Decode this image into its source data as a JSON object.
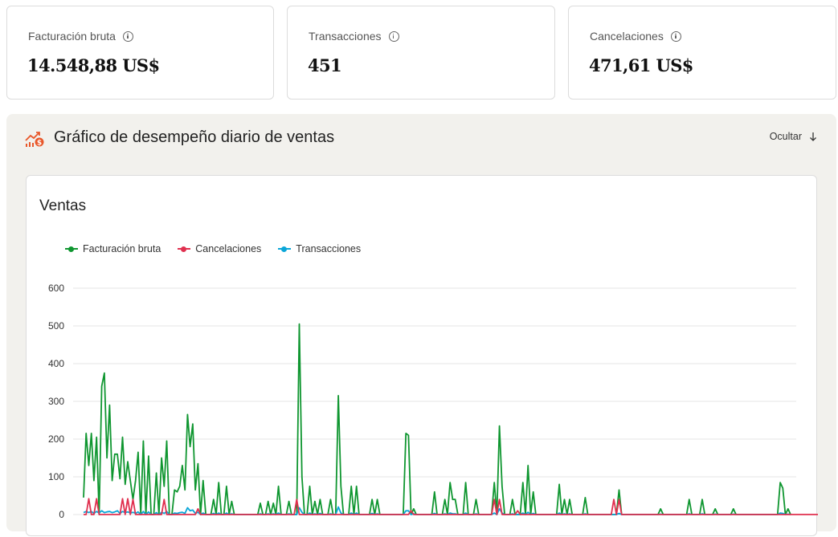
{
  "kpis": [
    {
      "label": "Facturación bruta",
      "value": "14.548,88 US$"
    },
    {
      "label": "Transacciones",
      "value": "451"
    },
    {
      "label": "Cancelaciones",
      "value": "471,61 US$"
    }
  ],
  "panel": {
    "title": "Gráfico de desempeño diario de ventas",
    "hide_label": "Ocultar"
  },
  "chart_data": {
    "type": "line",
    "title": "Ventas",
    "ylim": [
      0,
      600
    ],
    "yticks": [
      0,
      100,
      200,
      300,
      400,
      500,
      600
    ],
    "grid": true,
    "legend_position": "top-left",
    "colors": {
      "Facturación bruta": "#0f9630",
      "Cancelaciones": "#e0304f",
      "Transacciones": "#0aa6d8"
    },
    "series": [
      {
        "name": "Facturación bruta",
        "values": [
          45,
          215,
          130,
          215,
          90,
          205,
          0,
          340,
          375,
          150,
          290,
          90,
          160,
          160,
          95,
          205,
          80,
          140,
          90,
          40,
          90,
          165,
          0,
          195,
          0,
          155,
          0,
          0,
          110,
          0,
          150,
          75,
          195,
          0,
          0,
          65,
          60,
          75,
          130,
          65,
          265,
          180,
          240,
          65,
          135,
          0,
          90,
          0,
          0,
          0,
          40,
          0,
          85,
          0,
          0,
          75,
          0,
          35,
          0,
          0,
          0,
          0,
          0,
          0,
          0,
          0,
          0,
          0,
          30,
          0,
          0,
          35,
          0,
          30,
          0,
          75,
          0,
          0,
          0,
          35,
          0,
          0,
          0,
          505,
          100,
          0,
          0,
          75,
          0,
          35,
          0,
          40,
          0,
          0,
          0,
          40,
          0,
          0,
          315,
          75,
          0,
          0,
          0,
          75,
          0,
          75,
          0,
          0,
          0,
          0,
          0,
          40,
          0,
          40,
          0,
          0,
          0,
          0,
          0,
          0,
          0,
          0,
          0,
          0,
          215,
          210,
          0,
          15,
          0,
          0,
          0,
          0,
          0,
          0,
          0,
          60,
          0,
          0,
          0,
          40,
          0,
          85,
          40,
          40,
          0,
          0,
          0,
          85,
          0,
          0,
          0,
          40,
          0,
          0,
          0,
          0,
          0,
          0,
          85,
          0,
          235,
          75,
          0,
          0,
          0,
          40,
          0,
          0,
          0,
          85,
          0,
          130,
          0,
          60,
          0,
          0,
          0,
          0,
          0,
          0,
          0,
          0,
          0,
          80,
          0,
          40,
          0,
          40,
          0,
          0,
          0,
          0,
          0,
          45,
          0,
          0,
          0,
          0,
          0,
          0,
          0,
          0,
          0,
          0,
          0,
          0,
          65,
          0,
          0,
          0,
          0,
          0,
          0,
          0,
          0,
          0,
          0,
          0,
          0,
          0,
          0,
          0,
          15,
          0,
          0,
          0,
          0,
          0,
          0,
          0,
          0,
          0,
          0,
          40,
          0,
          0,
          0,
          0,
          40,
          0,
          0,
          0,
          0,
          15,
          0,
          0,
          0,
          0,
          0,
          0,
          15,
          0,
          0,
          0,
          0,
          0,
          0,
          0,
          0,
          0,
          0,
          0,
          0,
          0,
          0,
          0,
          0,
          0,
          85,
          70,
          0,
          15,
          0
        ]
      },
      {
        "name": "Cancelaciones",
        "values": [
          0,
          0,
          42,
          0,
          0,
          42,
          0,
          0,
          0,
          0,
          0,
          0,
          0,
          0,
          0,
          42,
          0,
          42,
          0,
          40,
          0,
          0,
          0,
          0,
          0,
          0,
          0,
          0,
          0,
          0,
          0,
          40,
          0,
          0,
          0,
          0,
          0,
          0,
          0,
          0,
          0,
          0,
          0,
          0,
          15,
          0,
          0,
          0,
          0,
          0,
          0,
          0,
          0,
          0,
          0,
          0,
          0,
          0,
          0,
          0,
          0,
          0,
          0,
          0,
          0,
          0,
          0,
          0,
          0,
          0,
          0,
          0,
          0,
          0,
          0,
          0,
          0,
          0,
          0,
          0,
          0,
          0,
          40,
          0,
          0,
          0,
          0,
          0,
          0,
          0,
          0,
          0,
          0,
          0,
          0,
          0,
          0,
          0,
          0,
          0,
          0,
          0,
          0,
          0,
          0,
          0,
          0,
          0,
          0,
          0,
          0,
          0,
          0,
          0,
          0,
          0,
          0,
          0,
          0,
          0,
          0,
          0,
          0,
          0,
          0,
          0,
          10,
          0,
          0,
          0,
          0,
          0,
          0,
          0,
          0,
          0,
          0,
          0,
          0,
          0,
          0,
          0,
          0,
          0,
          0,
          0,
          0,
          0,
          0,
          0,
          0,
          0,
          0,
          0,
          0,
          0,
          0,
          0,
          40,
          0,
          40,
          0,
          0,
          0,
          0,
          0,
          0,
          10,
          0,
          0,
          0,
          0,
          0,
          0,
          0,
          0,
          0,
          0,
          0,
          0,
          0,
          0,
          0,
          0,
          0,
          0,
          0,
          0,
          0,
          0,
          0,
          0,
          0,
          0,
          0,
          0,
          0,
          0,
          0,
          0,
          0,
          0,
          0,
          0,
          40,
          0,
          40,
          0,
          0,
          0,
          0,
          0,
          0,
          0,
          0,
          0,
          0,
          0,
          0,
          0,
          0,
          0,
          0,
          0,
          0,
          0,
          0,
          0,
          0,
          0,
          0,
          0,
          0,
          0,
          0,
          0,
          0,
          0,
          0,
          0,
          0,
          0,
          0,
          0,
          0,
          0,
          0,
          0,
          0,
          0,
          0,
          0,
          0,
          0,
          0,
          0,
          0,
          0,
          0,
          0,
          0,
          0,
          0,
          0,
          0,
          0,
          0,
          0,
          0,
          0,
          0,
          0,
          0,
          0,
          0,
          0,
          0,
          0,
          0,
          0,
          0,
          0,
          0,
          0,
          0,
          0,
          0,
          0,
          0
        ]
      },
      {
        "name": "Transacciones",
        "values": [
          5,
          8,
          5,
          8,
          3,
          8,
          4,
          10,
          5,
          7,
          8,
          5,
          7,
          10,
          3,
          8,
          5,
          7,
          4,
          6,
          3,
          7,
          0,
          8,
          0,
          7,
          0,
          0,
          5,
          0,
          6,
          3,
          8,
          0,
          0,
          4,
          3,
          5,
          6,
          3,
          18,
          10,
          12,
          3,
          6,
          0,
          4,
          0,
          0,
          0,
          3,
          0,
          4,
          0,
          0,
          4,
          0,
          2,
          0,
          0,
          0,
          0,
          0,
          0,
          0,
          0,
          0,
          0,
          2,
          0,
          0,
          2,
          0,
          2,
          0,
          4,
          0,
          0,
          0,
          2,
          0,
          0,
          0,
          18,
          6,
          0,
          0,
          4,
          0,
          2,
          0,
          3,
          0,
          0,
          0,
          2,
          0,
          0,
          20,
          4,
          0,
          0,
          0,
          4,
          0,
          4,
          0,
          0,
          0,
          0,
          0,
          3,
          0,
          2,
          0,
          0,
          0,
          0,
          0,
          0,
          0,
          0,
          0,
          0,
          10,
          10,
          0,
          2,
          0,
          0,
          0,
          0,
          0,
          0,
          0,
          3,
          0,
          0,
          0,
          2,
          0,
          4,
          2,
          2,
          0,
          0,
          0,
          4,
          0,
          0,
          0,
          2,
          0,
          0,
          0,
          0,
          0,
          0,
          4,
          0,
          15,
          4,
          0,
          0,
          0,
          2,
          0,
          0,
          0,
          4,
          0,
          6,
          0,
          3,
          0,
          0,
          0,
          0,
          0,
          0,
          0,
          0,
          0,
          4,
          0,
          2,
          0,
          2,
          0,
          0,
          0,
          0,
          0,
          2,
          0,
          0,
          0,
          0,
          0,
          0,
          0,
          0,
          0,
          0,
          0,
          0,
          3,
          0,
          0,
          0,
          0,
          0,
          0,
          0,
          0,
          0,
          0,
          0,
          0,
          0,
          0,
          0,
          1,
          0,
          0,
          0,
          0,
          0,
          0,
          0,
          0,
          0,
          0,
          2,
          0,
          0,
          0,
          0,
          2,
          0,
          0,
          0,
          0,
          1,
          0,
          0,
          0,
          0,
          0,
          0,
          1,
          0,
          0,
          0,
          0,
          0,
          0,
          0,
          0,
          0,
          0,
          0,
          0,
          0,
          0,
          0,
          0,
          0,
          4,
          3,
          0,
          1,
          0
        ]
      }
    ]
  }
}
